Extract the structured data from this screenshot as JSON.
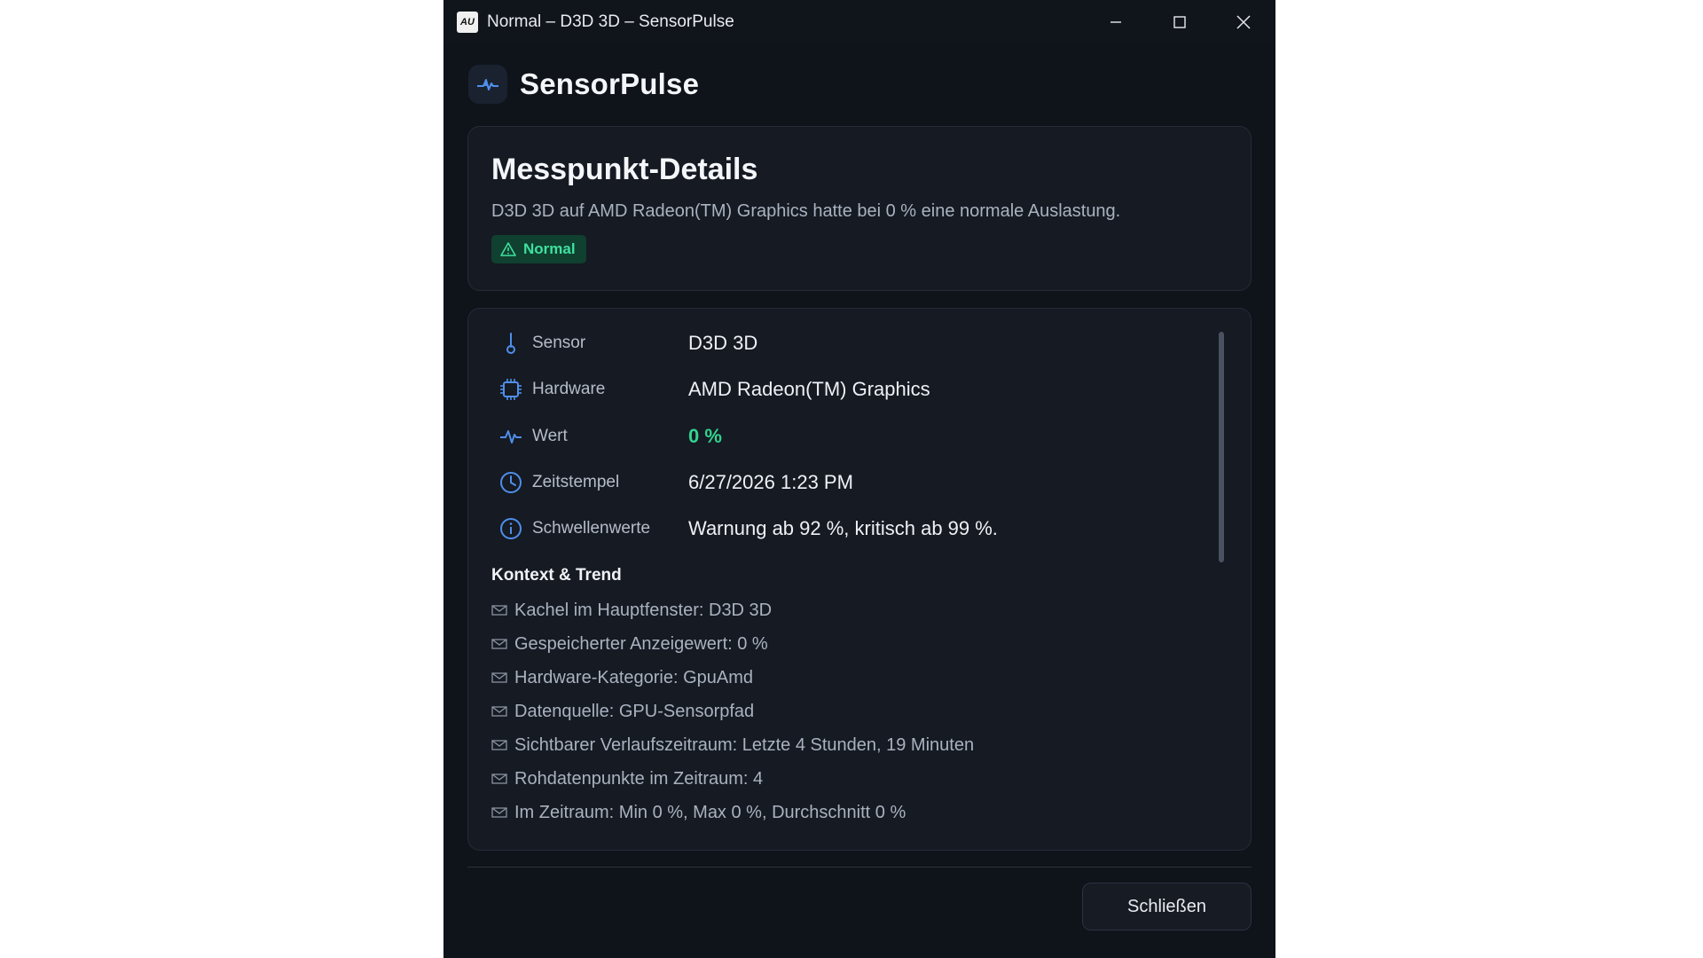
{
  "window": {
    "title": "Normal – D3D 3D – SensorPulse",
    "logo_text": "AU"
  },
  "brand": {
    "name": "SensorPulse",
    "icon": "pulse-icon"
  },
  "header": {
    "title": "Messpunkt-Details",
    "description": "D3D 3D auf AMD Radeon(TM) Graphics hatte bei 0 % eine normale Auslastung.",
    "badge": "Normal",
    "badge_icon": "warning-triangle-icon"
  },
  "details": [
    {
      "label": "Sensor",
      "value": "D3D 3D",
      "icon": "thermometer-icon"
    },
    {
      "label": "Hardware",
      "value": "AMD Radeon(TM) Graphics",
      "icon": "chip-icon"
    },
    {
      "label": "Wert",
      "value": "0 %",
      "icon": "pulse-icon"
    },
    {
      "label": "Zeitstempel",
      "value": "6/27/2026 1:23 PM",
      "icon": "clock-icon"
    },
    {
      "label": "Schwellenwerte",
      "value": "Warnung ab 92 %, kritisch ab 99 %.",
      "icon": "info-icon"
    }
  ],
  "context": {
    "title": "Kontext & Trend",
    "items": [
      "Kachel im Hauptfenster: D3D 3D",
      "Gespeicherter Anzeigewert: 0 %",
      "Hardware-Kategorie: GpuAmd",
      "Datenquelle: GPU-Sensorpfad",
      "Sichtbarer Verlaufszeitraum: Letzte 4 Stunden, 19 Minuten",
      "Rohdatenpunkte im Zeitraum: 4",
      "Im Zeitraum: Min 0 %, Max 0 %, Durchschnitt 0 %"
    ]
  },
  "footer": {
    "close_label": "Schließen"
  },
  "colors": {
    "background": "#0f131a",
    "card": "#151a23",
    "accent_blue": "#4f8fea",
    "accent_green": "#32d38f"
  }
}
